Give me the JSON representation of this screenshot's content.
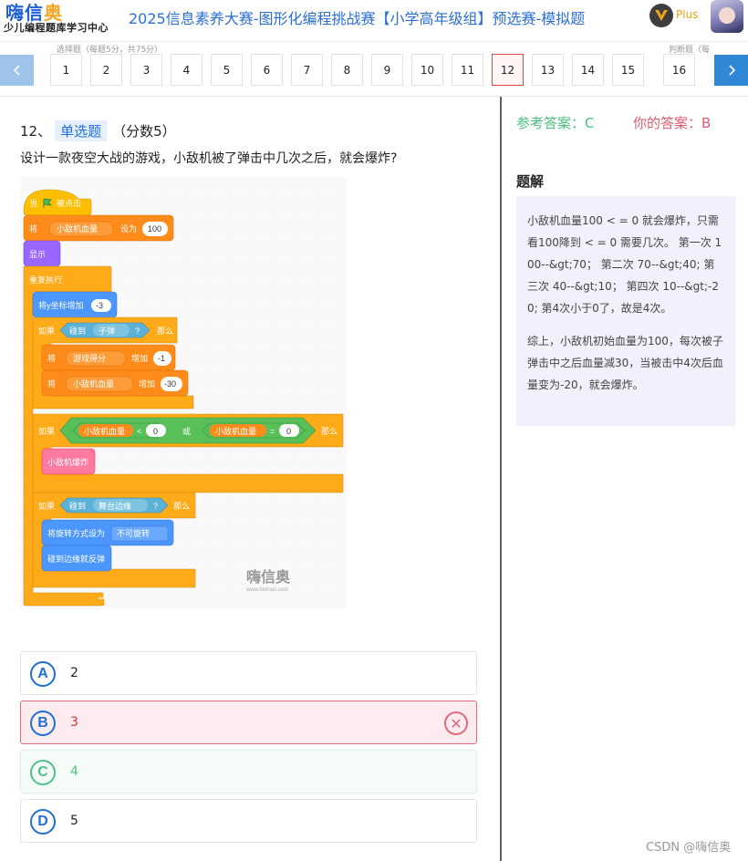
{
  "header": {
    "logo_main": "嗨信",
    "logo_accent": "奥",
    "logo_sub": "少儿编程题库学习中心",
    "title": "2025信息素养大赛-图形化编程挑战赛【小学高年级组】预选赛-模拟题",
    "plus_label": "Plus"
  },
  "nav": {
    "section_left": "选择题（每题5分，共75分）",
    "section_right": "判断题（每",
    "questions": [
      "1",
      "2",
      "3",
      "4",
      "5",
      "6",
      "7",
      "8",
      "9",
      "10",
      "11",
      "12",
      "13",
      "14",
      "15",
      "16"
    ],
    "active": "12",
    "prev_icon": "chevron-left-icon",
    "next_icon": "chevron-right-icon"
  },
  "question": {
    "number": "12、",
    "type": "单选题",
    "score": "（分数5）",
    "text": "设计一款夜空大战的游戏，小敌机被了弹击中几次之后，就会爆炸?"
  },
  "code_blocks": {
    "when_clicked": "当",
    "clicked": "被点击",
    "set": "将",
    "var_hp": "小敌机血量",
    "set_to": "设为",
    "set_value": "100",
    "show": "显示",
    "forever": "重复执行",
    "change_y": "将y坐标增加",
    "change_y_value": "-3",
    "if": "如果",
    "touching": "碰到",
    "bullet": "子弹",
    "question_mark": "?",
    "then": "那么",
    "var_score": "游戏得分",
    "change_by": "增加",
    "score_change": "-1",
    "hp_change": "-30",
    "lt": "<",
    "lt_value": "0",
    "or": "或",
    "eq": "=",
    "eq_value": "0",
    "explode": "小敌机爆炸",
    "edge": "舞台边缘",
    "rotation": "将旋转方式设为",
    "no_rotate": "不可旋转",
    "bounce": "碰到边缘就反弹",
    "watermark": "嗨信奥",
    "watermark_url": "www.hixinao.com"
  },
  "options": [
    {
      "letter": "A",
      "text": "2",
      "state": "normal"
    },
    {
      "letter": "B",
      "text": "3",
      "state": "wrong"
    },
    {
      "letter": "C",
      "text": "4",
      "state": "correct"
    },
    {
      "letter": "D",
      "text": "5",
      "state": "normal"
    }
  ],
  "answer": {
    "reference": "参考答案：C",
    "yours": "你的答案：B"
  },
  "solution": {
    "title": "题解",
    "p1": "小敌机血量100 < = 0 就会爆炸，只需看100降到 < = 0 需要几次。 第一次 100--&gt;70； 第二次 70--&gt;40; 第三次 40--&gt;10； 第四次 10--&gt;-20; 第4次小于0了，故是4次。",
    "p2": "综上，小敌机初始血量为100，每次被子弹击中之后血量减30，当被击中4次后血量变为-20，就会爆炸。"
  },
  "footer": "CSDN @嗨信奥",
  "colors": {
    "brand_blue": "#2b6fd6",
    "correct_green": "#4cbf7d",
    "wrong_red": "#e05a70",
    "events_orange": "#ffbf00",
    "control_orange": "#ffab19",
    "variables_orange": "#ff8c1a",
    "motion_blue": "#4c97ff",
    "looks_purple": "#9966ff",
    "sensing_blue": "#5cb1d6",
    "operators_green": "#59c059"
  }
}
